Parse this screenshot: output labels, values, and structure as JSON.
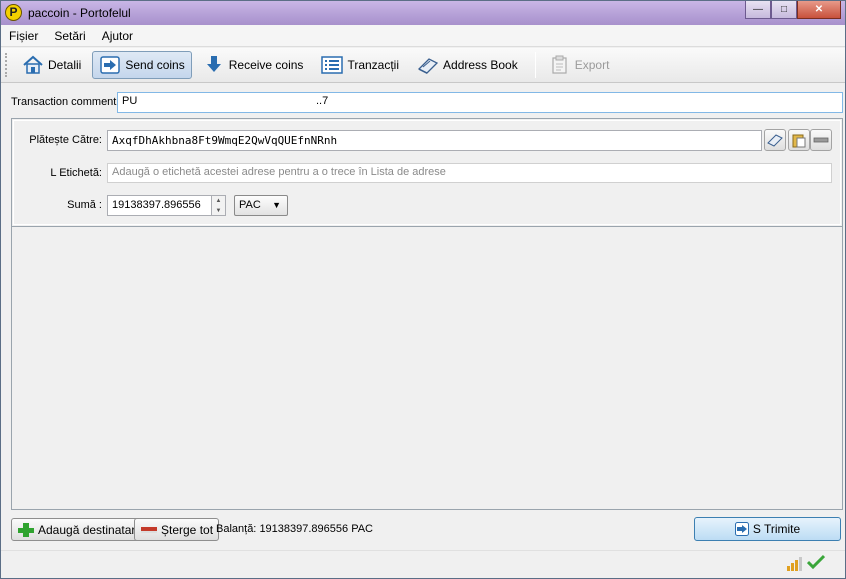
{
  "window": {
    "title": "paccoin - Portofelul",
    "app_icon_letter": "P",
    "controls": {
      "minimize": "—",
      "maximize": "□",
      "close": "✕"
    }
  },
  "menu": [
    "Fișier",
    "Setări",
    "Ajutor"
  ],
  "toolbar": {
    "overview": "Detalii",
    "send": "Send coins",
    "receive": "Receive coins",
    "transactions": "Tranzacții",
    "address_book": "Address Book",
    "export": "Export"
  },
  "comment": {
    "label": "Transaction comment:",
    "value_start": "PU",
    "value_end": "..7"
  },
  "recipient": {
    "pay_to_label": "Plătește Către:",
    "pay_to_value": "AxqfDhAkhbna8Ft9WmqE2QwVqQUEfnNRnh",
    "label_label": "L Etichetă:",
    "label_placeholder": "Adaugă o etichetă acestei adrese pentru a o trece în Lista de adrese",
    "amount_label": "Sumă :",
    "amount_value": "19138397.896556",
    "unit": "PAC"
  },
  "bottom": {
    "add_recipient": "Adaugă destinatar",
    "clear_all": "Șterge tot",
    "balance_label": "Balanță:",
    "balance_value": "19138397.896556 PAC",
    "send": "S Trimite"
  },
  "colors": {
    "titlebar": "#b49fd6",
    "accent_blue": "#2a6db0",
    "add_green": "#2fa32f",
    "clear_red": "#c43a2a",
    "check_green": "#3aa63a"
  }
}
